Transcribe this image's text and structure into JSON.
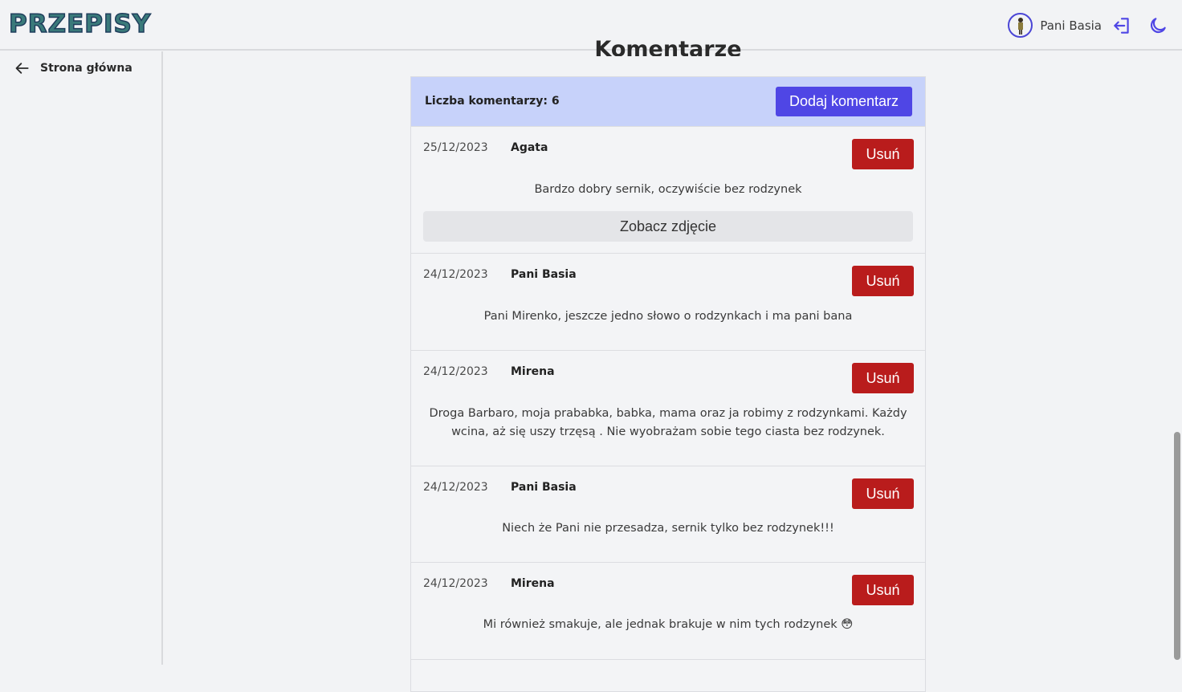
{
  "header": {
    "logo": "PRZEPISY",
    "user_name": "Pani Basia"
  },
  "sidebar": {
    "back_label": "Strona główna"
  },
  "section": {
    "title": "Komentarze"
  },
  "panel": {
    "count_label": "Liczba komentarzy: 6",
    "add_label": "Dodaj komentarz",
    "delete_label": "Usuń",
    "photo_label": "Zobacz zdjęcie"
  },
  "comments": [
    {
      "date": "25/12/2023",
      "author": "Agata",
      "text": "Bardzo dobry sernik, oczywiście bez rodzynek"
    },
    {
      "date": "24/12/2023",
      "author": "Pani Basia",
      "text": "Pani Mirenko, jeszcze jedno słowo o rodzynkach i ma pani bana"
    },
    {
      "date": "24/12/2023",
      "author": "Mirena",
      "text": "Droga Barbaro, moja prababka, babka, mama oraz ja robimy z rodzynkami. Każdy wcina, aż się uszy trzęsą . Nie wyobrażam sobie tego ciasta bez rodzynek."
    },
    {
      "date": "24/12/2023",
      "author": "Pani Basia",
      "text": "Niech że Pani nie przesadza, sernik tylko bez rodzynek!!!"
    },
    {
      "date": "24/12/2023",
      "author": "Mirena",
      "text": "Mi również smakuje, ale jednak brakuje w nim tych rodzynek 😳"
    }
  ],
  "colors": {
    "accent": "#4f46e5",
    "danger": "#b91c1c",
    "header_band": "#c7d2fa"
  }
}
